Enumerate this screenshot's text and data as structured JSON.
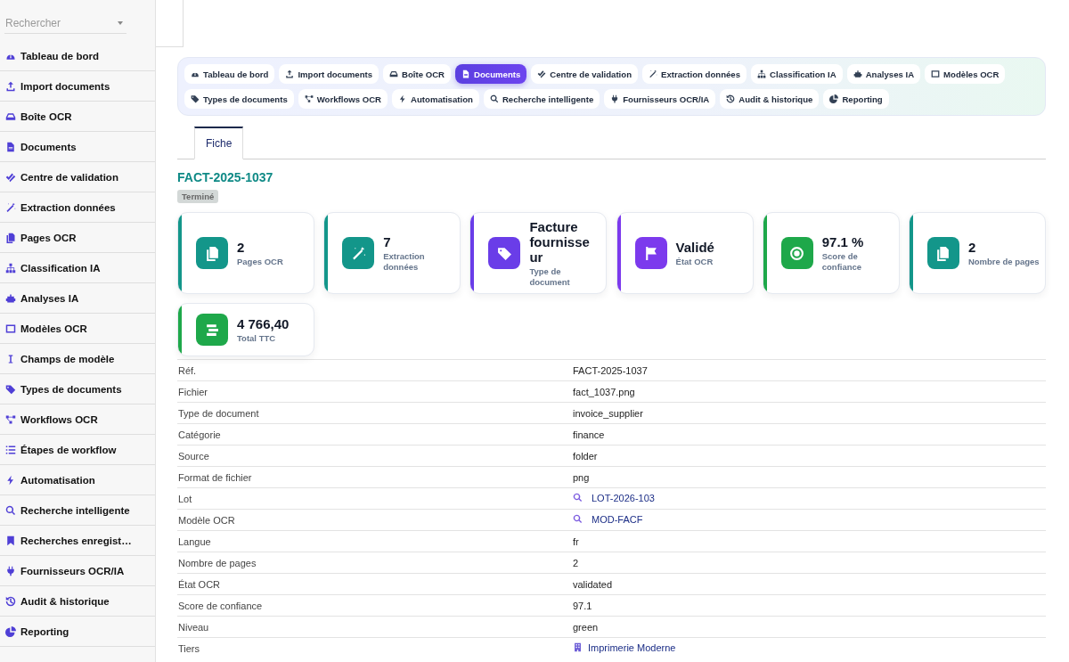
{
  "sidebar": {
    "search": {
      "placeholder": "Rechercher"
    },
    "items": [
      {
        "label": "Tableau de bord"
      },
      {
        "label": "Import documents"
      },
      {
        "label": "Boîte OCR"
      },
      {
        "label": "Documents"
      },
      {
        "label": "Centre de validation"
      },
      {
        "label": "Extraction données"
      },
      {
        "label": "Pages OCR"
      },
      {
        "label": "Classification IA"
      },
      {
        "label": "Analyses IA"
      },
      {
        "label": "Modèles OCR"
      },
      {
        "label": "Champs de modèle"
      },
      {
        "label": "Types de documents"
      },
      {
        "label": "Workflows OCR"
      },
      {
        "label": "Étapes de workflow"
      },
      {
        "label": "Automatisation"
      },
      {
        "label": "Recherche intelligente"
      },
      {
        "label": "Recherches enregist…"
      },
      {
        "label": "Fournisseurs OCR/IA"
      },
      {
        "label": "Audit & historique"
      },
      {
        "label": "Reporting"
      }
    ]
  },
  "nav": {
    "items": [
      {
        "label": "Tableau de bord",
        "selected": false
      },
      {
        "label": "Import documents",
        "selected": false
      },
      {
        "label": "Boîte OCR",
        "selected": false
      },
      {
        "label": "Documents",
        "selected": true
      },
      {
        "label": "Centre de validation",
        "selected": false
      },
      {
        "label": "Extraction données",
        "selected": false
      },
      {
        "label": "Classification IA",
        "selected": false
      },
      {
        "label": "Analyses IA",
        "selected": false
      },
      {
        "label": "Modèles OCR",
        "selected": false
      },
      {
        "label": "Types de documents",
        "selected": false
      },
      {
        "label": "Workflows OCR",
        "selected": false
      },
      {
        "label": "Automatisation",
        "selected": false
      },
      {
        "label": "Recherche intelligente",
        "selected": false
      },
      {
        "label": "Fournisseurs OCR/IA",
        "selected": false
      },
      {
        "label": "Audit & historique",
        "selected": false
      },
      {
        "label": "Reporting",
        "selected": false
      }
    ]
  },
  "tabs": [
    {
      "label": "Fiche",
      "selected": true
    }
  ],
  "record": {
    "title": "FACT-2025-1037",
    "status": "Terminé"
  },
  "stats": [
    {
      "value": "2",
      "label": "Pages OCR",
      "color": "#13968a"
    },
    {
      "value": "7",
      "label": "Extraction données",
      "color": "#13968a"
    },
    {
      "value": "Facture fournisseur",
      "label": "Type de document",
      "color": "#6a3de8"
    },
    {
      "value": "Validé",
      "label": "État OCR",
      "color": "#7c3aed"
    },
    {
      "value": "97.1 %",
      "label": "Score de confiance",
      "color": "#1ea84a"
    },
    {
      "value": "2",
      "label": "Nombre de pages",
      "color": "#13968a"
    },
    {
      "value": "4 766,40",
      "label": "Total TTC",
      "color": "#1ea84a"
    }
  ],
  "details": [
    {
      "label": "Réf.",
      "value": "FACT-2025-1037",
      "kind": "text"
    },
    {
      "label": "Fichier",
      "value": "fact_1037.png",
      "kind": "text"
    },
    {
      "label": "Type de document",
      "value": "invoice_supplier",
      "kind": "text"
    },
    {
      "label": "Catégorie",
      "value": "finance",
      "kind": "text"
    },
    {
      "label": "Source",
      "value": "folder",
      "kind": "text"
    },
    {
      "label": "Format de fichier",
      "value": "png",
      "kind": "text"
    },
    {
      "label": "Lot",
      "value": "LOT-2026-103",
      "kind": "lookup"
    },
    {
      "label": "Modèle OCR",
      "value": "MOD-FACF",
      "kind": "lookup"
    },
    {
      "label": "Langue",
      "value": "fr",
      "kind": "text"
    },
    {
      "label": "Nombre de pages",
      "value": "2",
      "kind": "text"
    },
    {
      "label": "État OCR",
      "value": "validated",
      "kind": "text"
    },
    {
      "label": "Score de confiance",
      "value": "97.1",
      "kind": "text"
    },
    {
      "label": "Niveau",
      "value": "green",
      "kind": "text"
    },
    {
      "label": "Tiers",
      "value": "Imprimerie Moderne",
      "kind": "company"
    }
  ]
}
